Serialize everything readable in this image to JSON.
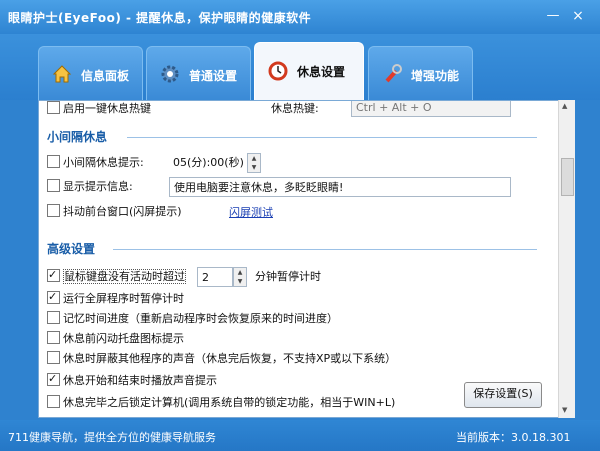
{
  "window": {
    "title": "眼睛护士(EyeFoo) - 提醒休息，保护眼睛的健康软件",
    "min": "—",
    "close": "×"
  },
  "tabs": [
    {
      "label": "信息面板",
      "icon": "house-icon"
    },
    {
      "label": "普通设置",
      "icon": "gear-icon"
    },
    {
      "label": "休息设置",
      "icon": "alarm-clock-icon"
    },
    {
      "label": "增强功能",
      "icon": "wrench-icon"
    }
  ],
  "top": {
    "hotkey_checkbox": "启用一键休息热键",
    "hotkey_label": "休息热键:",
    "hotkey_value": "Ctrl + Alt + O"
  },
  "short_break": {
    "title": "小间隔休息",
    "interval_label": "小间隔休息提示:",
    "interval_value": "05(分):00(秒)",
    "show_msg_label": "显示提示信息:",
    "msg_value": "使用电脑要注意休息，多眨眨眼睛!",
    "shake_label": "抖动前台窗口(闪屏提示)",
    "flash_test": "闪屏测试"
  },
  "advanced": {
    "title": "高级设置",
    "idle_label": "鼠标键盘没有活动时超过",
    "idle_value": "2",
    "idle_suffix": "分钟暂停计时",
    "options": [
      {
        "label": "运行全屏程序时暂停计时",
        "checked": true
      },
      {
        "label": "记忆时间进度（重新启动程序时会恢复原来的时间进度）",
        "checked": false
      },
      {
        "label": "休息前闪动托盘图标提示",
        "checked": false
      },
      {
        "label": "休息时屏蔽其他程序的声音（休息完后恢复，不支持XP或以下系统）",
        "checked": false
      },
      {
        "label": "休息开始和结束时播放声音提示",
        "checked": true
      },
      {
        "label": "休息完毕之后锁定计算机(调用系统自带的锁定功能，相当于WIN+L)",
        "checked": false
      }
    ],
    "idle_checked": true
  },
  "save_button": "保存设置(S)",
  "status": {
    "left": "711健康导航，提供全方位的健康导航服务",
    "right": "当前版本：3.0.18.301"
  }
}
